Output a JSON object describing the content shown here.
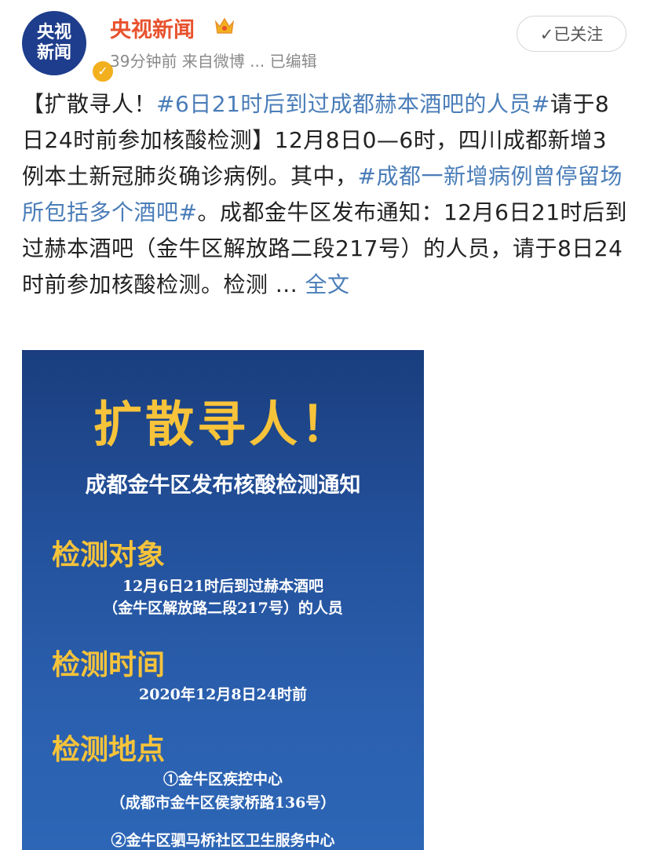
{
  "account": {
    "name": "央视新闻",
    "avatar_top": "央视",
    "avatar_bottom": "新闻",
    "meta": "39分钟前  来自微博 ...  已编辑",
    "follow_label": "✓已关注",
    "verified_icon": "verified-badge-icon",
    "crown_icon": "crown-icon"
  },
  "post": {
    "part1": "【扩散寻人！",
    "tag1": "#6日21时后到过成都赫本酒吧的人员#",
    "part2": "请于8日24时前参加核酸检测】12月8日0—6时，四川成都新增3例本土新冠肺炎确诊病例。其中，",
    "tag2": "#成都一新增病例曾停留场所包括多个酒吧#",
    "part3": "。成都金牛区发布通知：12月6日21时后到过赫本酒吧（金牛区解放路二段217号）的人员，请于8日24时前参加核酸检测。检测 ... ",
    "more": "全文"
  },
  "poster": {
    "title": "扩散寻人！",
    "subtitle": "成都金牛区发布核酸检测通知",
    "target_head": "检测对象",
    "target_line1": "12月6日21时后到过赫本酒吧",
    "target_line2": "（金牛区解放路二段217号）的人员",
    "time_head": "检测时间",
    "time_line": "2020年12月8日24时前",
    "place_head": "检测地点",
    "place1_name": "①金牛区疾控中心",
    "place1_addr": "（成都市金牛区侯家桥路136号）",
    "place2_name": "②金牛区驷马桥社区卫生服务中心"
  },
  "colors": {
    "brand": "#e8522e",
    "link": "#4a7db8",
    "poster_bg": "#23509a",
    "poster_accent": "#f6c33a"
  }
}
